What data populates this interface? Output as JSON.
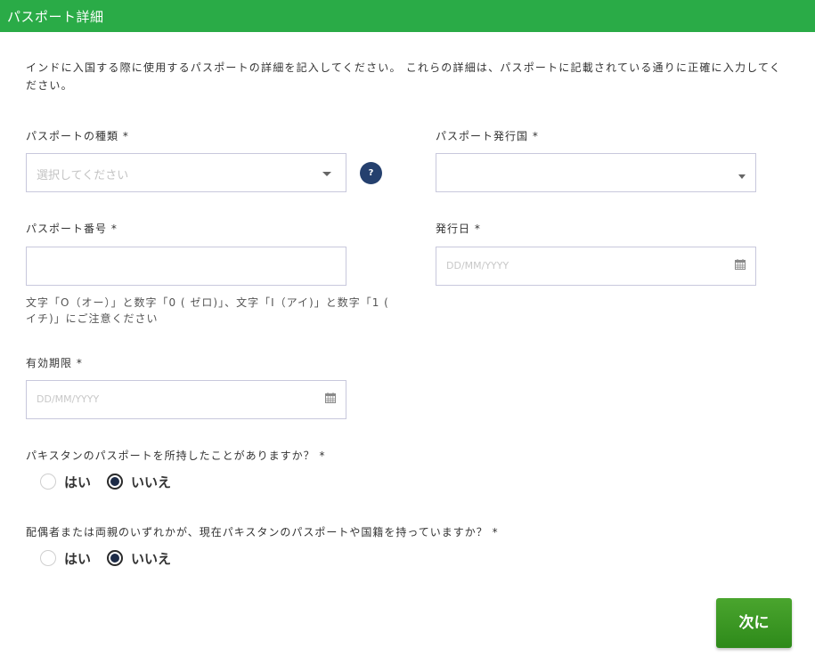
{
  "header": {
    "title": "パスポート詳細"
  },
  "intro": "インドに入国する際に使用するパスポートの詳細を記入してください。 これらの詳細は、パスポートに記載されている通りに正確に入力してください。",
  "passport_type": {
    "label": "パスポートの種類 *",
    "placeholder": "選択してください"
  },
  "help_icon": "?",
  "issuing_country": {
    "label": "パスポート発行国 *",
    "value": ""
  },
  "passport_number": {
    "label": "パスポート番号 *",
    "value": "",
    "hint": "文字「O（オー）」と数字「0 ( ゼロ)」、文字「I（アイ)」と数字「1 ( イチ)」にご注意ください"
  },
  "issue_date": {
    "label": "発行日 *",
    "placeholder": "DD/MM/YYYY"
  },
  "expiry_date": {
    "label": "有効期限 *",
    "placeholder": "DD/MM/YYYY"
  },
  "q_pakistan_passport": {
    "label": "パキスタンのパスポートを所持したことがありますか？ *",
    "options": [
      "はい",
      "いいえ"
    ],
    "selected": "いいえ"
  },
  "q_family_pakistan": {
    "label": "配偶者または両親のいずれかが、現在パキスタンのパスポートや国籍を持っていますか？ *",
    "options": [
      "はい",
      "いいえ"
    ],
    "selected": "いいえ"
  },
  "next_button": {
    "label": "次に"
  },
  "colors": {
    "header_bg": "#2aab47",
    "button_green": "#3a9a24",
    "help_bg": "#25406e",
    "radio_fill": "#1d2b47"
  },
  "icons": {
    "dropdown": "chevron-down-icon",
    "calendar": "calendar-icon",
    "help": "help-icon"
  }
}
